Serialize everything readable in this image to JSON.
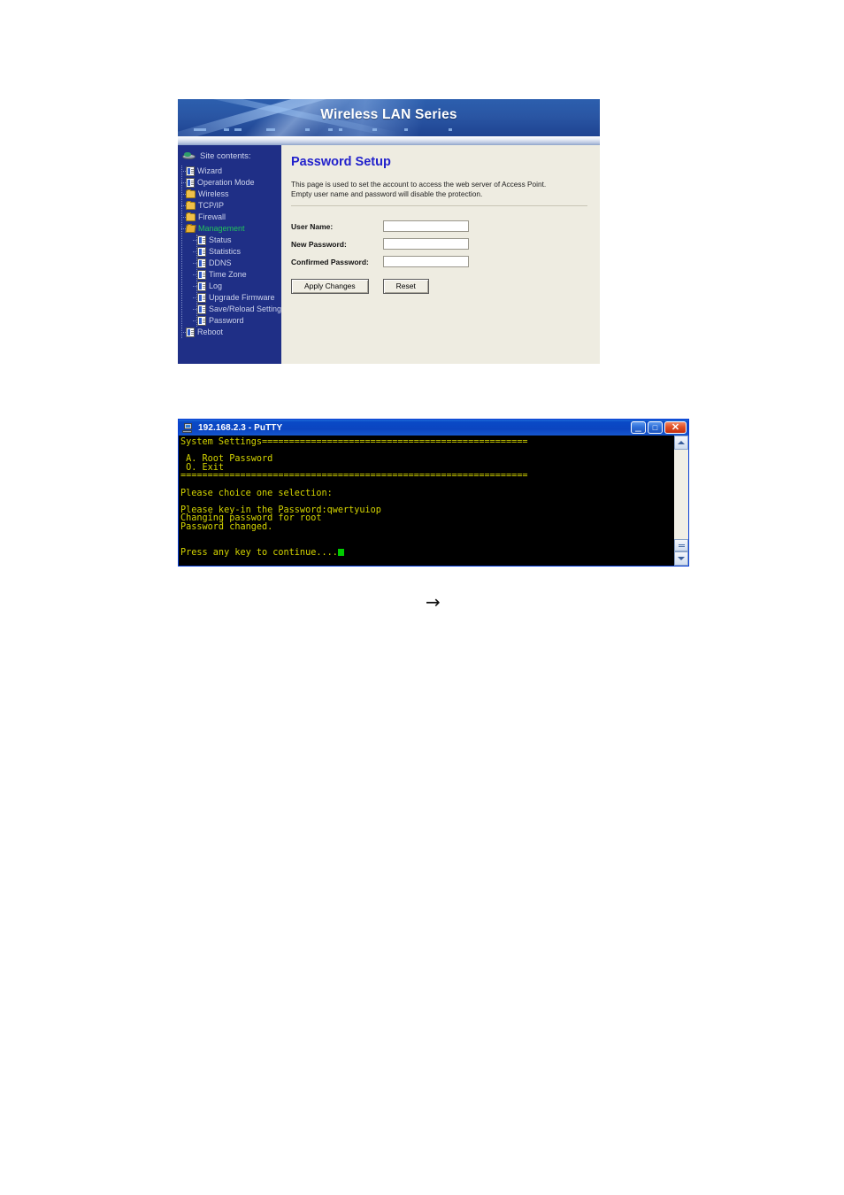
{
  "router_ui": {
    "banner_title": "Wireless LAN Series",
    "sidebar": {
      "heading": "Site contents:",
      "heading_icon": "disk-icon",
      "items": [
        {
          "label": "Wizard",
          "icon": "page-icon",
          "level": 1,
          "selected": false
        },
        {
          "label": "Operation Mode",
          "icon": "page-icon",
          "level": 1,
          "selected": false
        },
        {
          "label": "Wireless",
          "icon": "folder-icon",
          "level": 1,
          "selected": false
        },
        {
          "label": "TCP/IP",
          "icon": "folder-icon",
          "level": 1,
          "selected": false
        },
        {
          "label": "Firewall",
          "icon": "folder-icon",
          "level": 1,
          "selected": false
        },
        {
          "label": "Management",
          "icon": "folder-open-icon",
          "level": 1,
          "selected": true
        },
        {
          "label": "Status",
          "icon": "page-icon",
          "level": 2,
          "selected": false
        },
        {
          "label": "Statistics",
          "icon": "page-icon",
          "level": 2,
          "selected": false
        },
        {
          "label": "DDNS",
          "icon": "page-icon",
          "level": 2,
          "selected": false
        },
        {
          "label": "Time Zone",
          "icon": "page-icon",
          "level": 2,
          "selected": false
        },
        {
          "label": "Log",
          "icon": "page-icon",
          "level": 2,
          "selected": false
        },
        {
          "label": "Upgrade Firmware",
          "icon": "page-icon",
          "level": 2,
          "selected": false
        },
        {
          "label": "Save/Reload Setting",
          "icon": "page-icon",
          "level": 2,
          "selected": false
        },
        {
          "label": "Password",
          "icon": "page-icon",
          "level": 2,
          "selected": false
        },
        {
          "label": "Reboot",
          "icon": "page-icon",
          "level": 1,
          "selected": false
        }
      ]
    },
    "content": {
      "title": "Password Setup",
      "description_line1": "This page is used to set the account to access the web server of Access Point.",
      "description_line2": "Empty user name and password will disable the protection.",
      "fields": [
        {
          "label": "User Name:",
          "value": "",
          "placeholder": ""
        },
        {
          "label": "New Password:",
          "value": "",
          "placeholder": ""
        },
        {
          "label": "Confirmed Password:",
          "value": "",
          "placeholder": ""
        }
      ],
      "apply_label": "Apply Changes",
      "reset_label": "Reset"
    },
    "colors": {
      "sidebar_bg": "#1f2f86",
      "content_bg": "#eeece1",
      "title_color": "#2222cc",
      "selected_item": "#22c35a"
    }
  },
  "putty": {
    "title": "192.168.2.3 - PuTTY",
    "icon": "putty-terminal-icon",
    "window_buttons": {
      "minimize": "_",
      "maximize": "□",
      "close": "✕"
    },
    "terminal": {
      "fg_color": "#d4d400",
      "bg_color": "#000000",
      "cursor_color": "#00cc00",
      "lines": [
        "System Settings=================================================",
        "",
        " A. Root Password",
        " O. Exit",
        "================================================================",
        "",
        "Please choice one selection:",
        "",
        "Please key-in the Password:qwertyuiop",
        "Changing password for root",
        "Password changed.",
        "",
        "",
        "Press any key to continue...."
      ]
    },
    "scrollbar": {
      "up_arrow": "scroll-up-icon",
      "down_arrow": "scroll-down-icon",
      "thumb_position": "bottom"
    }
  },
  "flow": {
    "arrow": "→"
  }
}
